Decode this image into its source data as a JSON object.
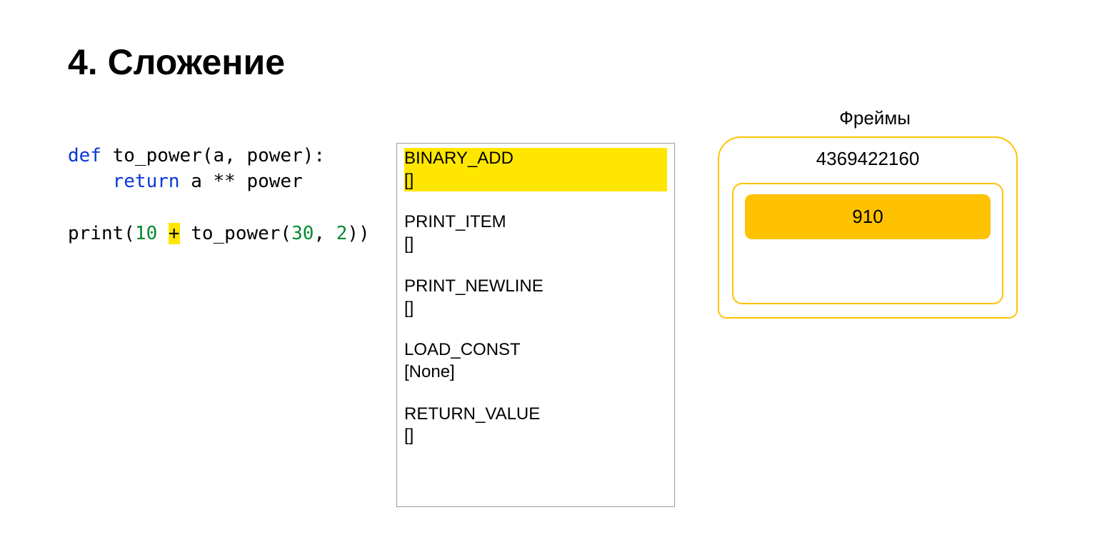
{
  "title": "4. Сложение",
  "code": {
    "kw_def": "def",
    "fn_name": " to_power(a, power):",
    "kw_return": "return",
    "ret_expr": " a ** power",
    "print_open": "print(",
    "num1": "10",
    "space_op_left": " ",
    "op_plus": "+",
    "space_op_right": " ",
    "call": "to_power(",
    "num2": "30",
    "comma_sp": ", ",
    "num3": "2",
    "call_close": "))"
  },
  "bytecode": [
    {
      "op": "BINARY_ADD",
      "args": "[]",
      "highlight": true
    },
    {
      "op": "PRINT_ITEM",
      "args": "[]",
      "highlight": false
    },
    {
      "op": "PRINT_NEWLINE",
      "args": "[]",
      "highlight": false
    },
    {
      "op": "LOAD_CONST",
      "args": "[None]",
      "highlight": false
    },
    {
      "op": "RETURN_VALUE",
      "args": "[]",
      "highlight": false
    }
  ],
  "frames": {
    "label": "Фреймы",
    "outer_id": "4369422160",
    "stack": [
      "910"
    ]
  }
}
